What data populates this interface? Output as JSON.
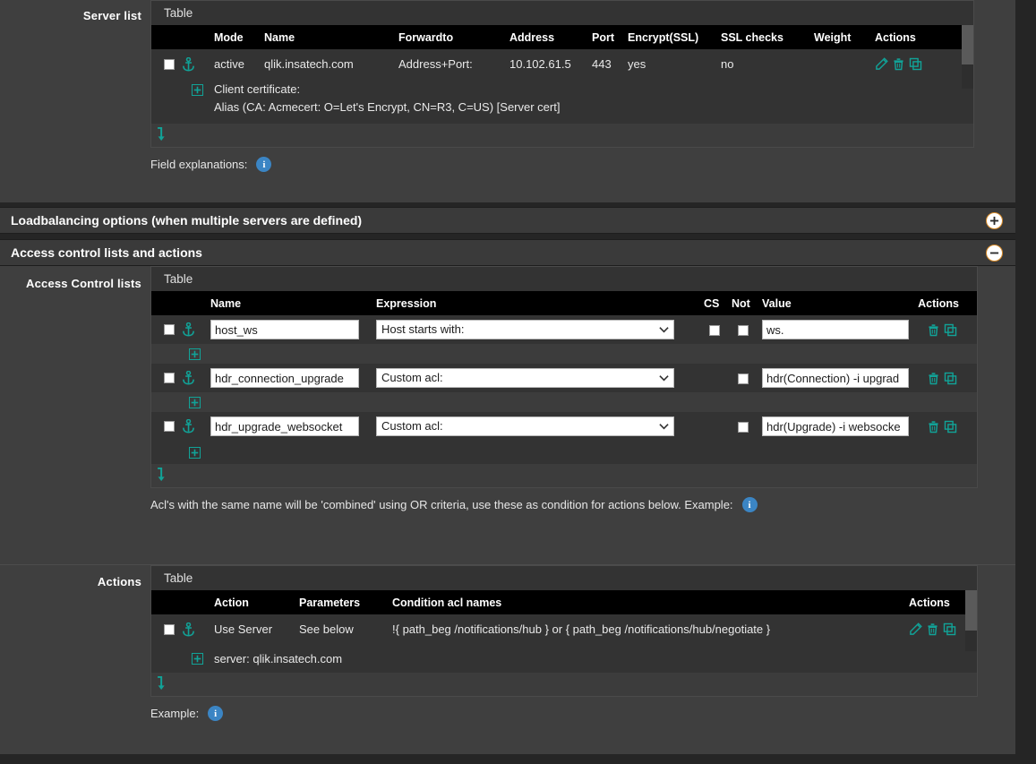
{
  "labels": {
    "server_list": "Server list",
    "access_control_lists": "Access Control lists",
    "actions": "Actions"
  },
  "sections": [
    {
      "title": "Loadbalancing options (when multiple servers are defined)",
      "toggle": "plus-icon",
      "expanded": false
    },
    {
      "title": "Access control lists and actions",
      "toggle": "minus-icon",
      "expanded": true
    }
  ],
  "server_table": {
    "caption": "Table",
    "columns": [
      "Mode",
      "Name",
      "Forwardto",
      "Address",
      "Port",
      "Encrypt(SSL)",
      "SSL checks",
      "Weight",
      "Actions"
    ],
    "rows": [
      {
        "checked": false,
        "anchor_icon": "anchor-icon",
        "mode": "active",
        "name": "qlik.insatech.com",
        "forwardto": "Address+Port:",
        "address": "10.102.61.5",
        "port": "443",
        "encrypt_ssl": "yes",
        "ssl_checks": "no",
        "weight": "",
        "actions": [
          "edit-icon",
          "delete-icon",
          "copy-icon"
        ],
        "detail": {
          "expand_icon": "plus-expand-icon",
          "line1": "Client certificate:",
          "line2": "Alias (CA: Acmecert: O=Let's Encrypt, CN=R3, C=US) [Server cert]"
        }
      }
    ],
    "footer_icon": "insert-arrow-icon",
    "hint": "Field explanations:",
    "hint_icon": "info-icon"
  },
  "acl_table": {
    "caption": "Table",
    "columns": [
      "Name",
      "Expression",
      "CS",
      "Not",
      "Value",
      "Actions"
    ],
    "rows": [
      {
        "checked": false,
        "anchor_icon": "anchor-icon",
        "name": "host_ws",
        "expression": "Host starts with:",
        "has_cs": true,
        "cs_checked": false,
        "not_checked": false,
        "value": "ws.",
        "actions": [
          "delete-icon",
          "copy-icon"
        ]
      },
      {
        "checked": false,
        "anchor_icon": "anchor-icon",
        "name": "hdr_connection_upgrade",
        "expression": "Custom acl:",
        "has_cs": false,
        "cs_checked": false,
        "not_checked": false,
        "value": "hdr(Connection) -i upgrad",
        "actions": [
          "delete-icon",
          "copy-icon"
        ]
      },
      {
        "checked": false,
        "anchor_icon": "anchor-icon",
        "name": "hdr_upgrade_websocket",
        "expression": "Custom acl:",
        "has_cs": false,
        "cs_checked": false,
        "not_checked": false,
        "value": "hdr(Upgrade) -i websocke",
        "actions": [
          "delete-icon",
          "copy-icon"
        ]
      }
    ],
    "add_icon": "plus-expand-icon",
    "footer_icon": "insert-arrow-icon",
    "hint": "Acl's with the same name will be 'combined' using OR criteria, use these as condition for actions below. Example:",
    "hint_icon": "info-icon"
  },
  "actions_table": {
    "caption": "Table",
    "columns": [
      "Action",
      "Parameters",
      "Condition acl names",
      "Actions"
    ],
    "rows": [
      {
        "checked": false,
        "anchor_icon": "anchor-icon",
        "action": "Use Server",
        "parameters": "See below",
        "condition": "!{ path_beg /notifications/hub } or { path_beg /notifications/hub/negotiate }",
        "actions": [
          "edit-icon",
          "delete-icon",
          "copy-icon"
        ],
        "detail": {
          "expand_icon": "plus-expand-icon",
          "line1": "server: qlik.insatech.com"
        }
      }
    ],
    "footer_icon": "insert-arrow-icon",
    "hint": "Example:",
    "hint_icon": "info-icon"
  },
  "colors": {
    "accent_teal": "#11a398",
    "info_blue": "#3b85c4",
    "panel_bg": "#3f3f3f",
    "table_bg": "#333333",
    "header_bg": "#000000",
    "toggle_outline": "#d98b28"
  }
}
